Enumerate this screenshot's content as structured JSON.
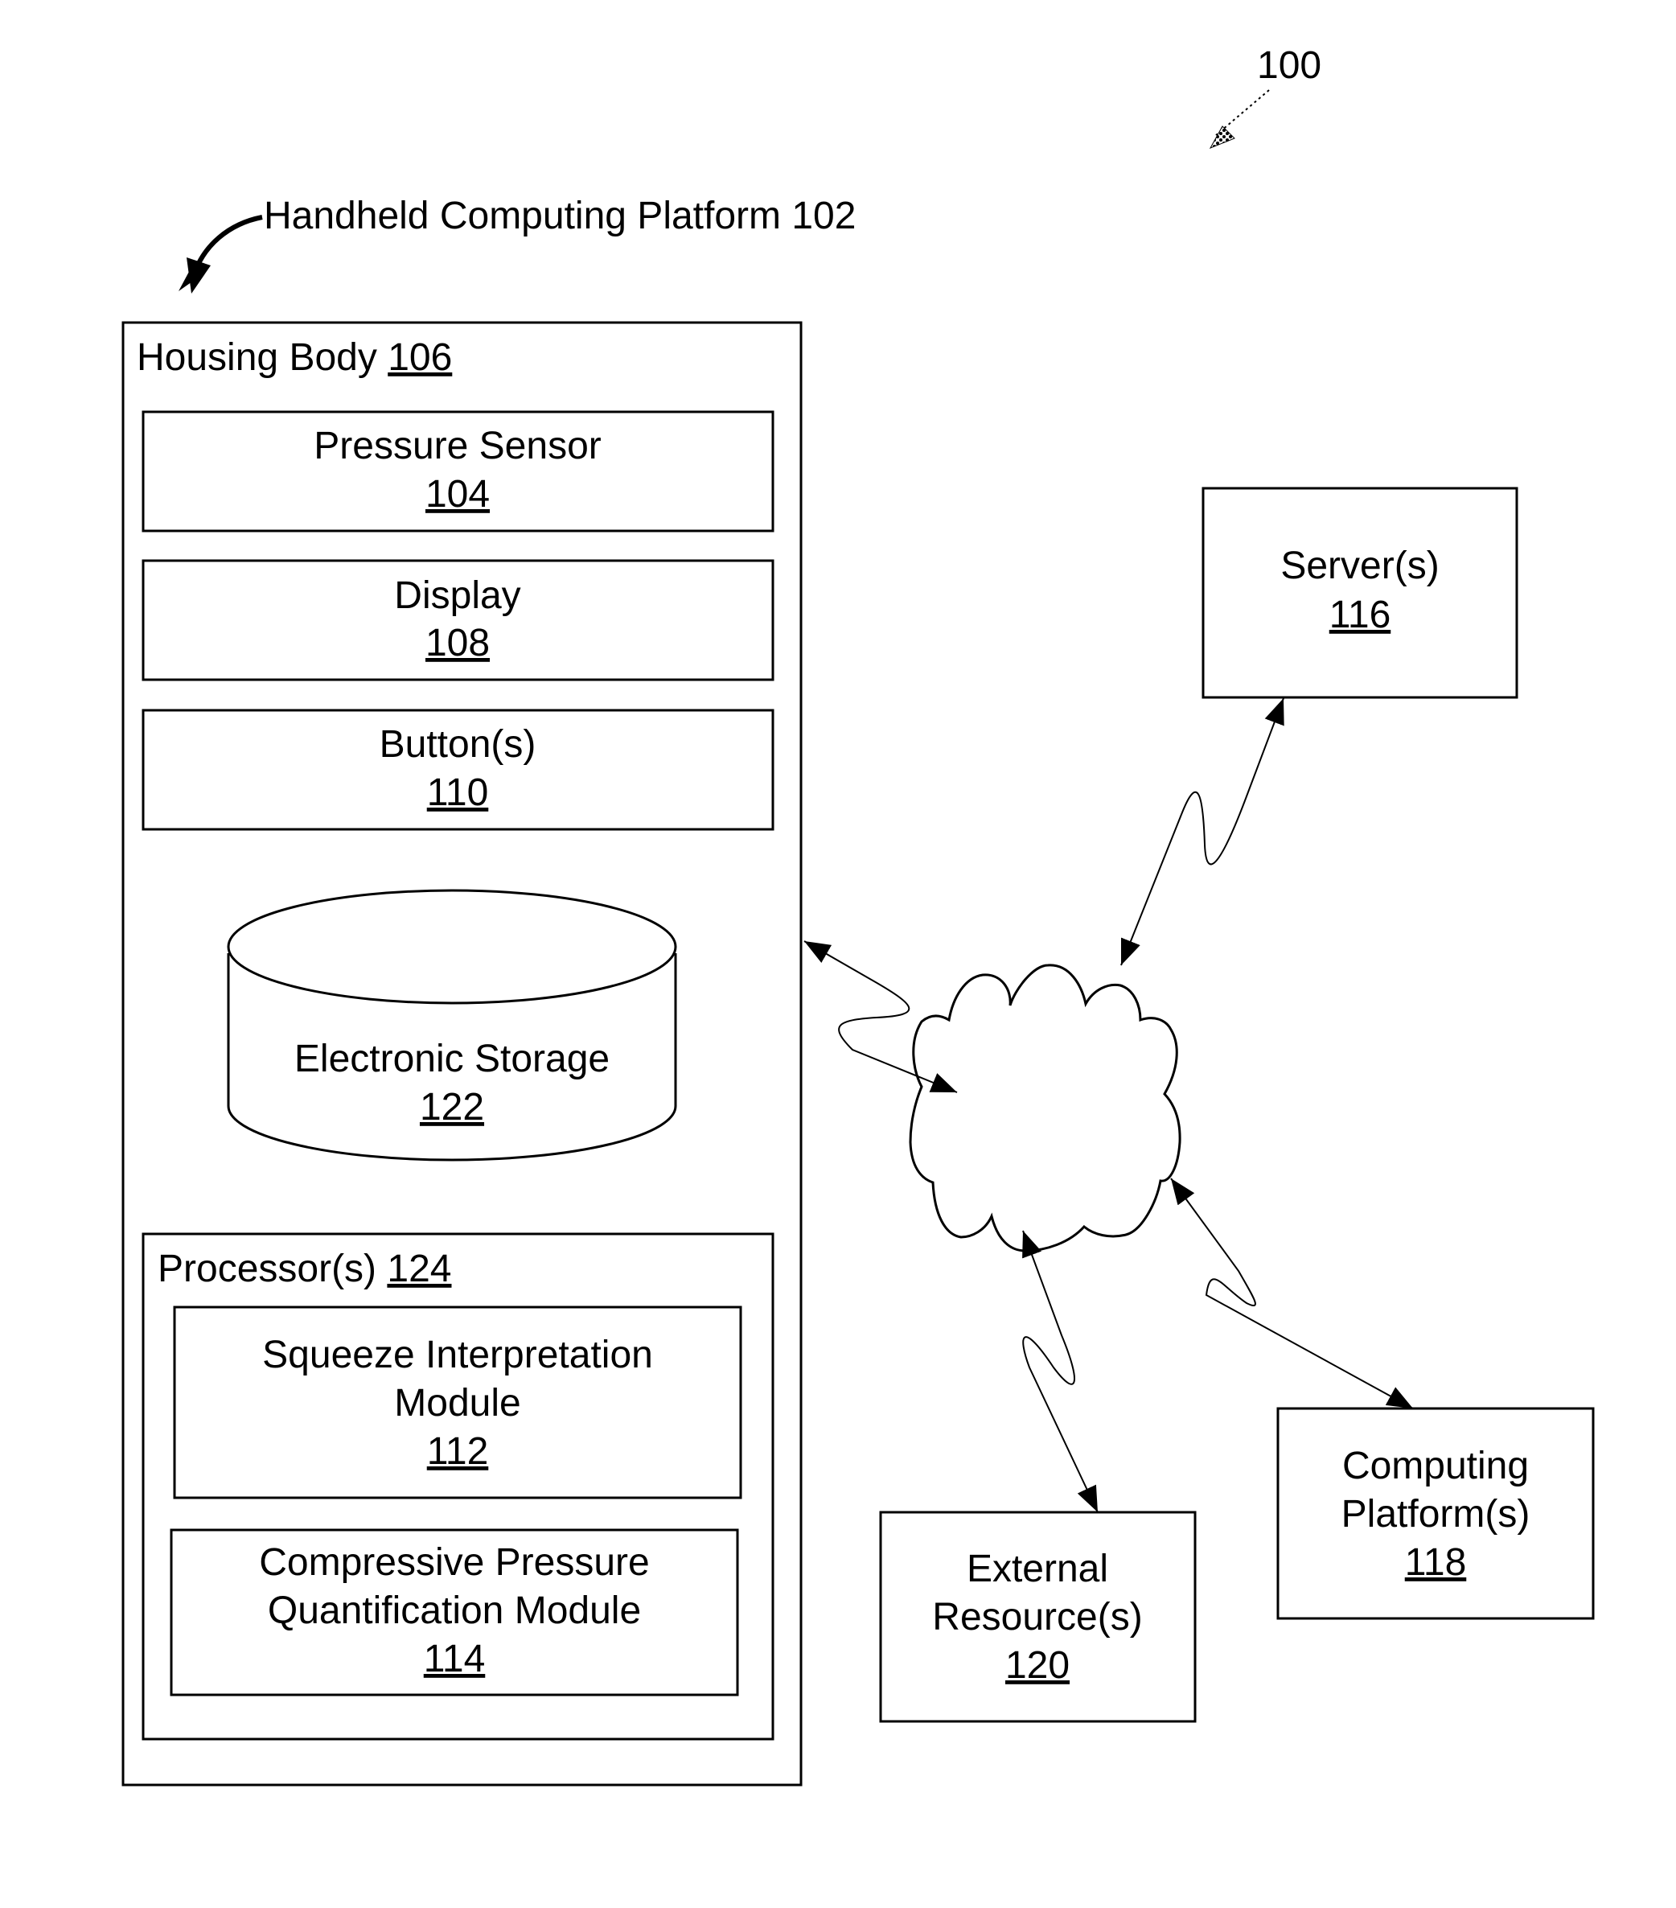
{
  "figure": {
    "reference": "100",
    "platform_label": "Handheld Computing Platform 102"
  },
  "housing": {
    "title": "Housing Body",
    "ref": "106"
  },
  "components": {
    "pressure_sensor": {
      "lines": [
        "Pressure Sensor"
      ],
      "ref": "104"
    },
    "display": {
      "lines": [
        "Display"
      ],
      "ref": "108"
    },
    "buttons": {
      "lines": [
        "Button(s)"
      ],
      "ref": "110"
    },
    "storage": {
      "lines": [
        "Electronic Storage"
      ],
      "ref": "122"
    }
  },
  "processor": {
    "title": "Processor(s)",
    "ref": "124",
    "modules": [
      {
        "lines": [
          "Squeeze Interpretation",
          "Module"
        ],
        "ref": "112"
      },
      {
        "lines": [
          "Compressive Pressure",
          "Quantification Module"
        ],
        "ref": "114"
      }
    ]
  },
  "external": {
    "servers": {
      "lines": [
        "Server(s)"
      ],
      "ref": "116"
    },
    "computing_platforms": {
      "lines": [
        "Computing",
        "Platform(s)"
      ],
      "ref": "118"
    },
    "external_resources": {
      "lines": [
        "External",
        "Resource(s)"
      ],
      "ref": "120"
    }
  },
  "network": {
    "icon": "cloud-icon"
  }
}
